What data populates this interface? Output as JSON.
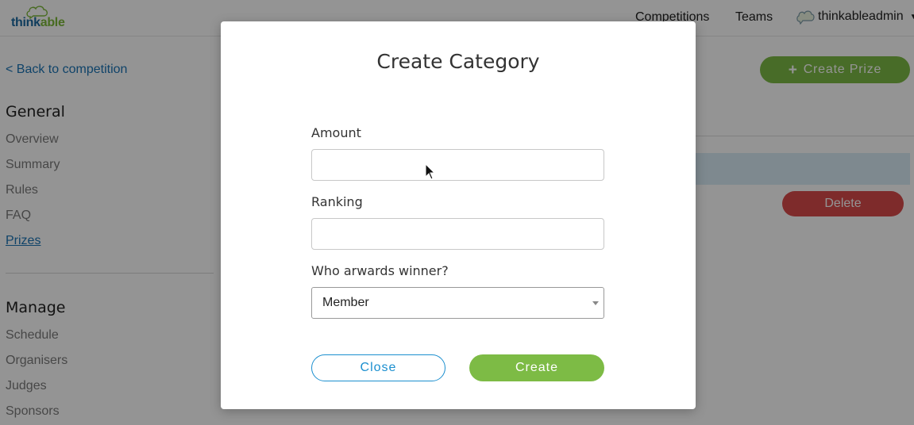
{
  "app": {
    "logo_part1": "think",
    "logo_part2": "able"
  },
  "topnav": {
    "competitions": "Competitions",
    "teams": "Teams",
    "username": "thinkableadmin"
  },
  "sidebar": {
    "back_link": "< Back to competition",
    "general_heading": "General",
    "general_items": [
      "Overview",
      "Summary",
      "Rules",
      "FAQ",
      "Prizes"
    ],
    "manage_heading": "Manage",
    "manage_items": [
      "Schedule",
      "Organisers",
      "Judges",
      "Sponsors"
    ]
  },
  "main": {
    "create_prize_label": "Create Prize",
    "delete_label": "Delete"
  },
  "modal": {
    "title": "Create Category",
    "amount_label": "Amount",
    "amount_value": "",
    "ranking_label": "Ranking",
    "ranking_value": "",
    "awarder_label": "Who arwards winner?",
    "awarder_selected": "Member",
    "close_label": "Close",
    "create_label": "Create"
  },
  "colors": {
    "brand_blue": "#1c6aa0",
    "brand_green": "#7dbb45",
    "link_blue": "#1b74b5",
    "danger_red": "#d94a4a",
    "close_outline": "#1b8fcf"
  },
  "icons": {
    "logo": "thinkable-cloud-icon",
    "user_avatar": "cloud-avatar-icon",
    "user_menu": "caret-down-icon",
    "create_prize": "plus-icon",
    "select_caret": "select-caret-icon"
  }
}
